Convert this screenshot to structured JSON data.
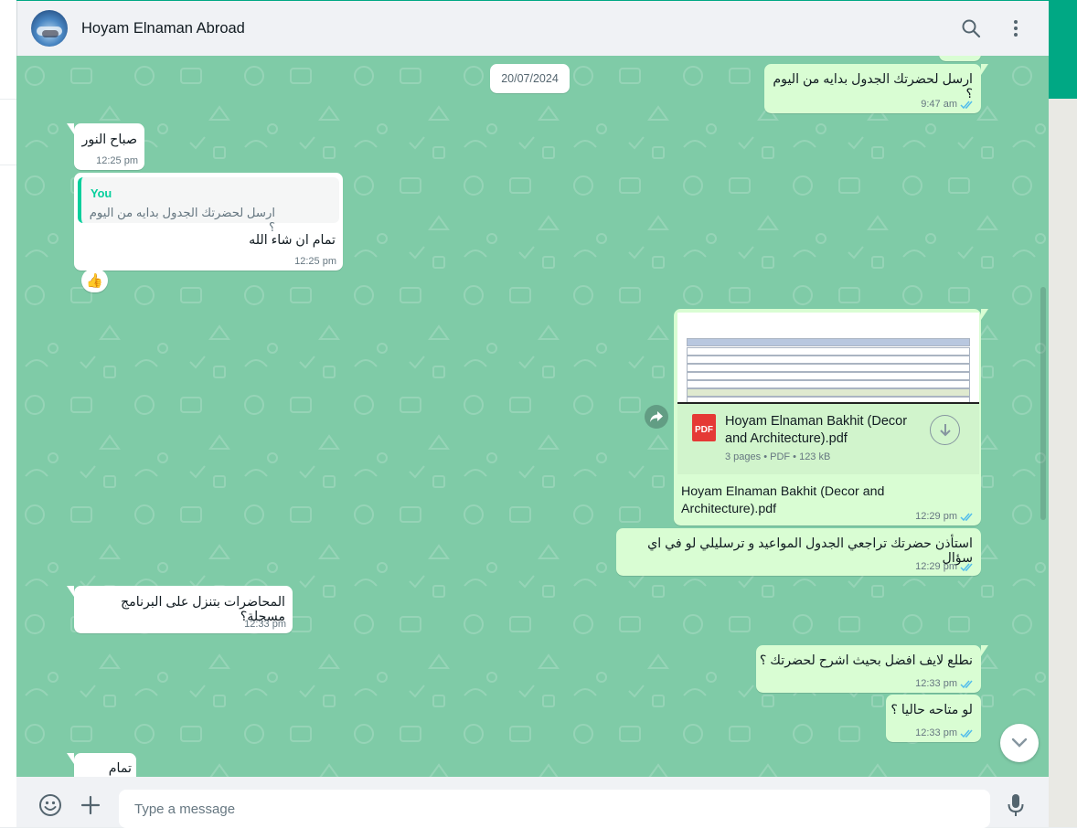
{
  "header": {
    "contact_name": "Hoyam Elnaman Abroad"
  },
  "date_chip": "20/07/2024",
  "messages": [
    {
      "id": "m0",
      "dir": "out",
      "text": "ارسل لحضرتك الجدول بدايه من اليوم ؟",
      "time": "9:47 am",
      "read": true
    },
    {
      "id": "m1",
      "dir": "in",
      "text": "صباح النور",
      "time": "12:25 pm"
    },
    {
      "id": "m2",
      "dir": "in",
      "quote_author": "You",
      "quote_text": "ارسل لحضرتك الجدول بدايه من اليوم ؟",
      "text": "تمام ان شاء الله",
      "time": "12:25 pm",
      "reaction": "👍"
    },
    {
      "id": "m3",
      "dir": "out",
      "type": "document",
      "file_name": "Hoyam Elnaman Bakhit (Decor and Architecture).pdf",
      "file_info": "3 pages • PDF • 123 kB",
      "icon_label": "PDF",
      "caption": "Hoyam Elnaman Bakhit (Decor and Architecture).pdf",
      "time": "12:29 pm",
      "read": true
    },
    {
      "id": "m4",
      "dir": "out",
      "text": "استأذن حضرتك تراجعي الجدول المواعيد و ترسليلي لو في اي سؤال",
      "time": "12:29 pm",
      "read": true
    },
    {
      "id": "m5",
      "dir": "in",
      "text": "المحاضرات بتنزل على البرنامج مسجلة؟",
      "time": "12:33 pm"
    },
    {
      "id": "m6",
      "dir": "out",
      "text": "نطلع لايف افضل بحيث اشرح لحضرتك ؟",
      "time": "12:33 pm",
      "read": true
    },
    {
      "id": "m7",
      "dir": "out",
      "text": "لو متاحه حاليا ؟",
      "time": "12:33 pm",
      "read": true
    },
    {
      "id": "m8",
      "dir": "in",
      "text": "تمام",
      "time": ""
    }
  ],
  "footer": {
    "placeholder": "Type a message"
  },
  "colors": {
    "accent": "#00a884",
    "chat_bg": "#7fcba7",
    "out_bubble": "#d9fdd3",
    "in_bubble": "#ffffff",
    "read_ticks": "#53bdeb"
  },
  "icons": {
    "search": "search-icon",
    "menu": "menu-dots-icon",
    "emoji": "emoji-icon",
    "attach": "plus-icon",
    "mic": "mic-icon",
    "download": "download-icon",
    "forward": "forward-icon",
    "scroll_down": "chevron-down-icon"
  }
}
